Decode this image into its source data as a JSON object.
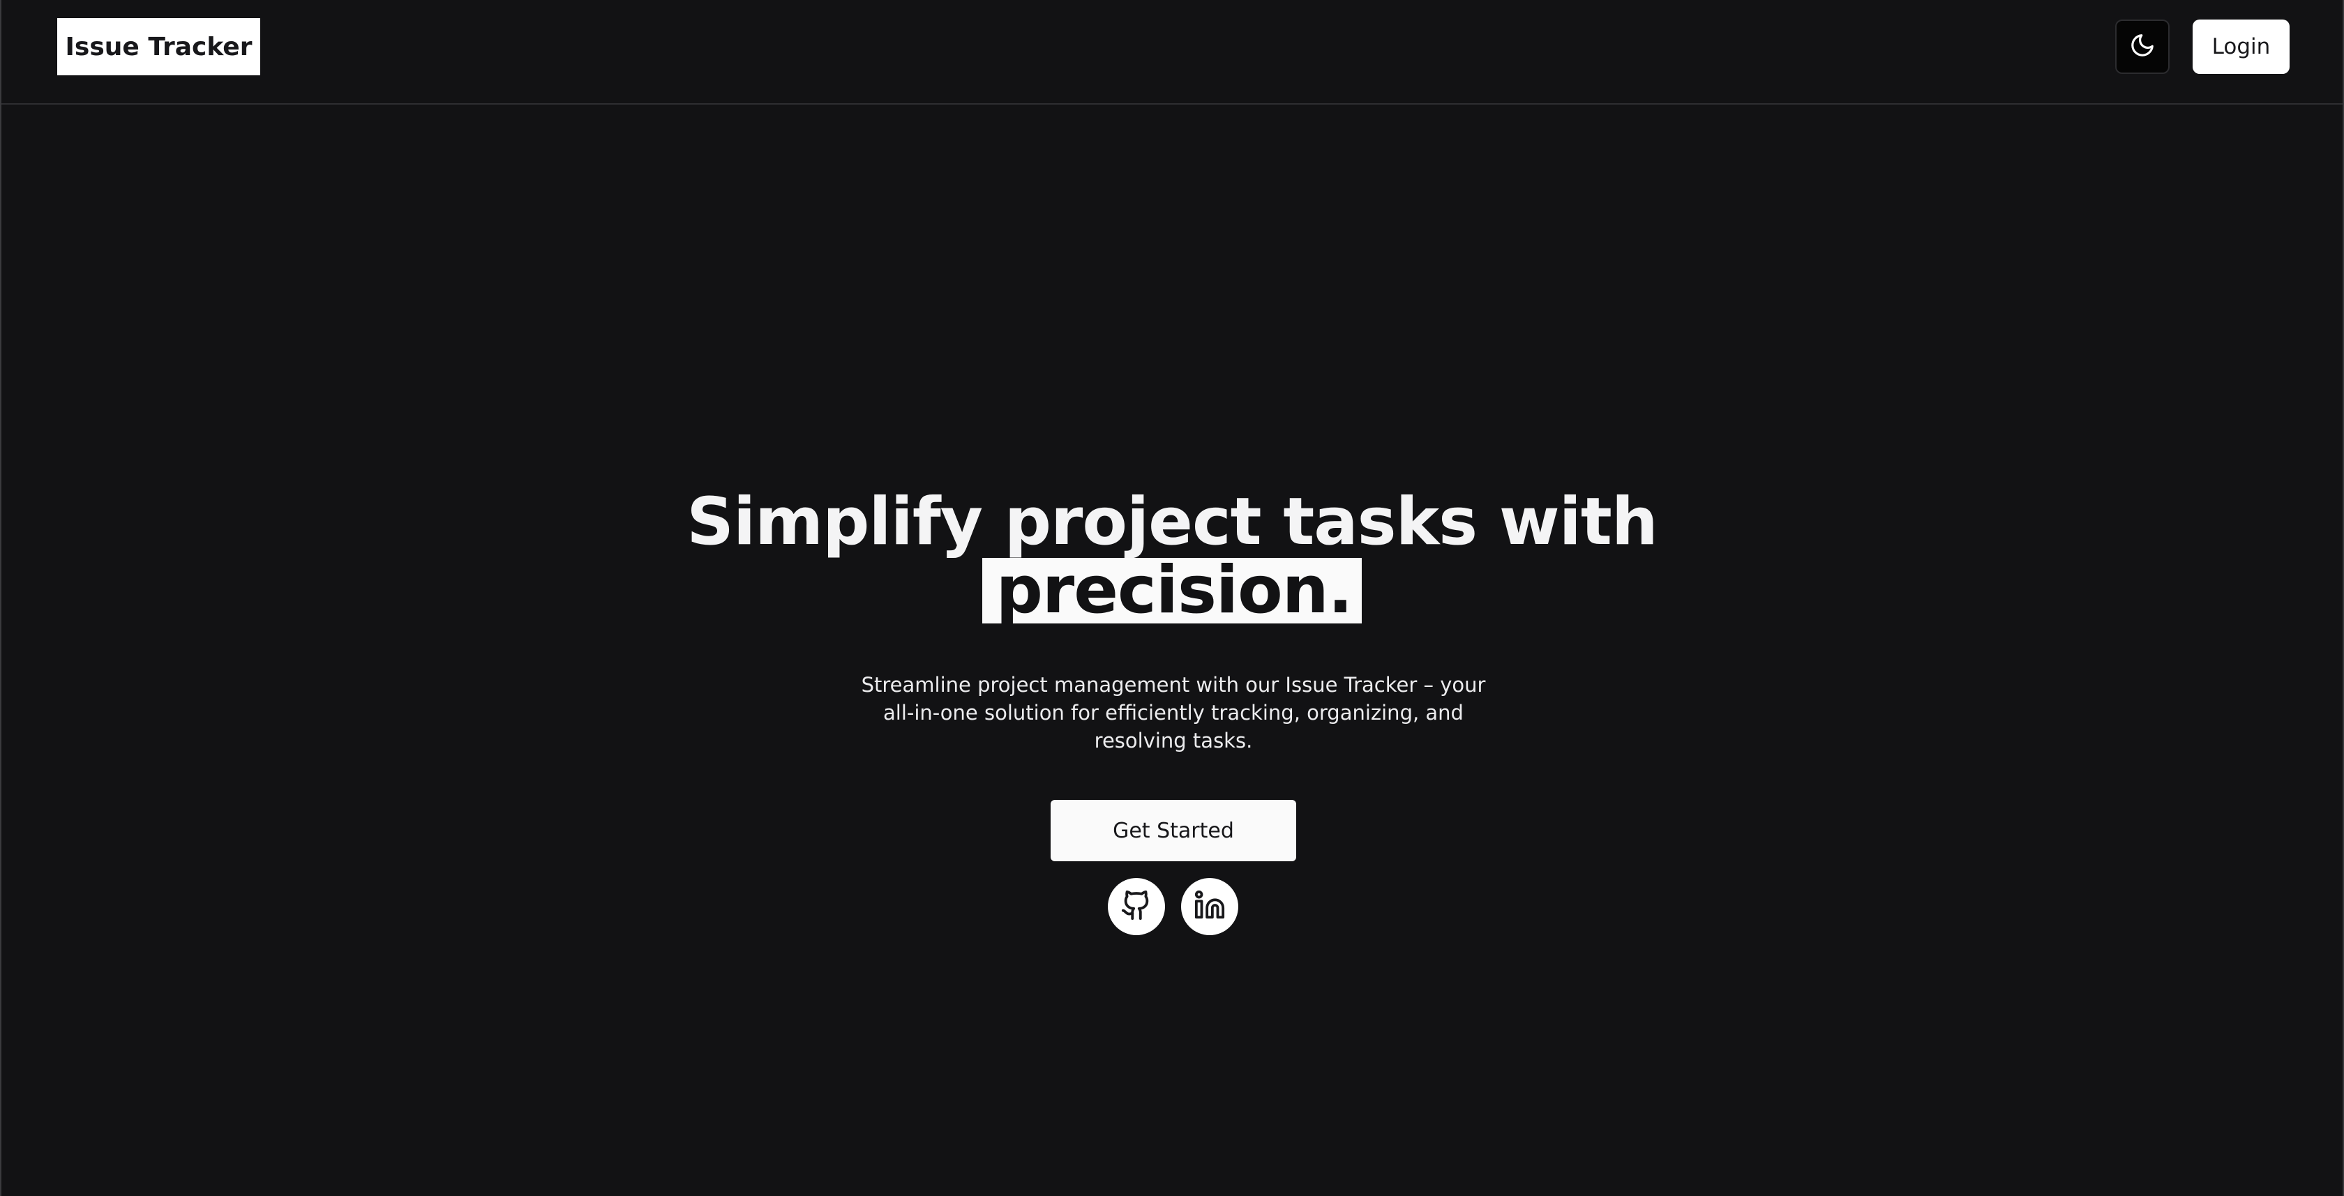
{
  "header": {
    "brand": "Issue Tracker",
    "theme_toggle_icon": "moon-icon",
    "login_label": "Login"
  },
  "hero": {
    "headline_line1": "Simplify project tasks with",
    "headline_highlight": "precision.",
    "subtitle": "Streamline project management with our Issue Tracker – your all-in-one solution for efficiently tracking, organizing, and resolving tasks.",
    "cta_label": "Get Started",
    "social_links": [
      {
        "icon": "github-icon"
      },
      {
        "icon": "linkedin-icon"
      }
    ]
  },
  "colors": {
    "background": "#121214",
    "foreground": "#f4f4f5",
    "surface_light": "#ffffff",
    "toggle_background": "#050505"
  }
}
